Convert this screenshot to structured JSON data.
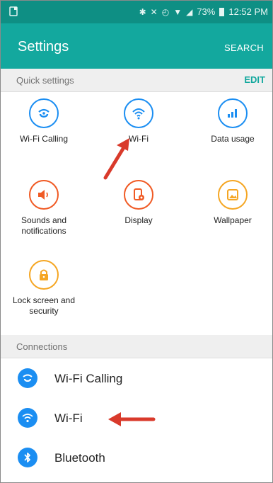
{
  "status_bar": {
    "battery": "73%",
    "time": "12:52 PM"
  },
  "app_bar": {
    "title": "Settings",
    "search": "SEARCH"
  },
  "quick_settings": {
    "header": "Quick settings",
    "edit": "EDIT",
    "items": [
      {
        "label": "Wi-Fi Calling",
        "icon": "wifi-calling-icon",
        "color": "#1b8ef2"
      },
      {
        "label": "Wi-Fi",
        "icon": "wifi-icon",
        "color": "#1b8ef2"
      },
      {
        "label": "Data usage",
        "icon": "data-usage-icon",
        "color": "#1b8ef2"
      },
      {
        "label": "Sounds and notifications",
        "icon": "sound-icon",
        "color": "#f05a24"
      },
      {
        "label": "Display",
        "icon": "display-icon",
        "color": "#f05a24"
      },
      {
        "label": "Wallpaper",
        "icon": "wallpaper-icon",
        "color": "#f5a623"
      },
      {
        "label": "Lock screen and security",
        "icon": "lock-icon",
        "color": "#f5a623"
      }
    ]
  },
  "connections": {
    "header": "Connections",
    "items": [
      {
        "label": "Wi-Fi Calling",
        "icon": "wifi-calling-icon"
      },
      {
        "label": "Wi-Fi",
        "icon": "wifi-icon"
      },
      {
        "label": "Bluetooth",
        "icon": "bluetooth-icon"
      }
    ]
  },
  "colors": {
    "status_bar": "#0e8f84",
    "app_bar": "#13a89e",
    "blue": "#1b8ef2",
    "orange": "#f05a24",
    "yellow": "#f5a623",
    "annotation_arrow": "#d93a2b"
  }
}
